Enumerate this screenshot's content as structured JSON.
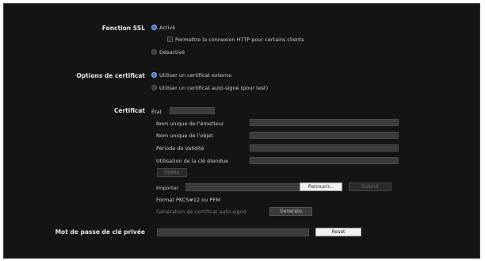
{
  "ssl": {
    "label": "Fonction SSL",
    "active": "Activé",
    "allow_http": "Permettre la connexion HTTP pour certains clients",
    "inactive": "Désactivé"
  },
  "cert_options": {
    "label": "Options de certificat",
    "external": "Utiliser un certificat externe",
    "self_signed": "Utiliser un certificat auto-signé (pour test)"
  },
  "certificate": {
    "label": "Certificat",
    "state": "État",
    "issuer": "Nom unique de l'émetteur",
    "subject": "Nom unique de l'objet",
    "validity": "Période de Validité",
    "key_usage": "Utilisation de la clé étendue",
    "delete_button": "Delete",
    "import_label": "Importer",
    "browse_button": "Parcourir...",
    "submit_button": "Submit",
    "format": "Format PKCS#12 ou PEM",
    "generate_label": "Génération de certificat auto-signé",
    "generate_button": "Generate"
  },
  "private_key": {
    "label": "Mot de passe de clé privée",
    "reset_button": "Reset"
  },
  "colors": {
    "background": "#141414",
    "radio_selected": "#3c6fd8"
  }
}
